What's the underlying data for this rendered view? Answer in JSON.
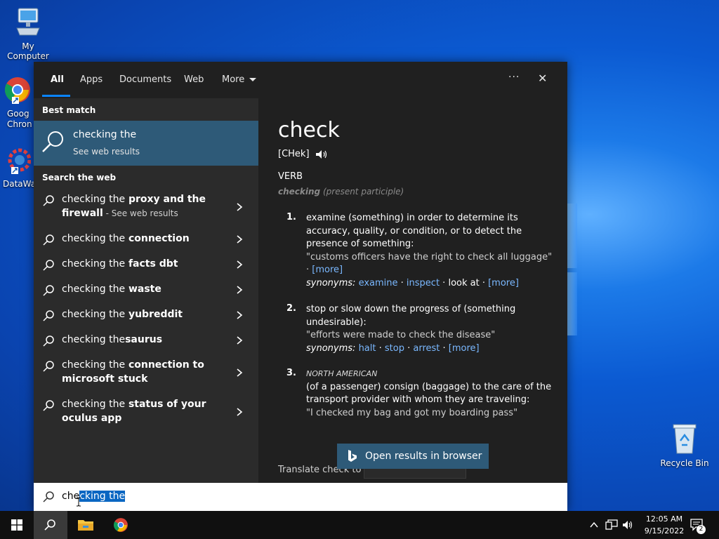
{
  "desktop": {
    "icons": [
      {
        "name": "my-computer",
        "label": "My Computer"
      },
      {
        "name": "google-chrome",
        "label": "Goog Chron"
      },
      {
        "name": "datawag",
        "label": "DataWag"
      },
      {
        "name": "recycle-bin",
        "label": "Recycle Bin"
      }
    ]
  },
  "search_panel": {
    "tabs": [
      {
        "label": "All",
        "active": true
      },
      {
        "label": "Apps"
      },
      {
        "label": "Documents"
      },
      {
        "label": "Web"
      },
      {
        "label": "More"
      }
    ],
    "more_options_label": "···",
    "close_label": "✕",
    "best_match": {
      "heading": "Best match",
      "title": "checking the",
      "subtitle": "See web results"
    },
    "search_web_heading": "Search the web",
    "suggestions": [
      {
        "prefix": "checking the",
        "bold": " proxy and the firewall",
        "suffix": " - See web results"
      },
      {
        "prefix": "checking the",
        "bold": " connection",
        "suffix": ""
      },
      {
        "prefix": "checking the",
        "bold": " facts dbt",
        "suffix": ""
      },
      {
        "prefix": "checking the",
        "bold": " waste",
        "suffix": ""
      },
      {
        "prefix": "checking the",
        "bold": " yubreddit",
        "suffix": ""
      },
      {
        "prefix": "checking the",
        "bold": "saurus",
        "suffix": ""
      },
      {
        "prefix": "checking the",
        "bold": " connection to microsoft stuck",
        "suffix": ""
      },
      {
        "prefix": "checking the",
        "bold": " status of your oculus app",
        "suffix": ""
      }
    ],
    "dictionary": {
      "word": "check",
      "pronunciation": "[CHek]",
      "part_of_speech": "VERB",
      "inflection_word": "checking",
      "inflection_note": " (present participle)",
      "definitions": [
        {
          "number": "1.",
          "text": "examine (something) in order to determine its accuracy, quality, or condition, or to detect the presence of something:",
          "example": "\"customs officers have the right to check all luggage\"",
          "example_more": "[more]",
          "synonyms_label": "synonyms:",
          "synonyms": [
            "examine",
            "inspect"
          ],
          "synonym_plain": "look at",
          "synonyms_more": "[more]"
        },
        {
          "number": "2.",
          "text": "stop or slow down the progress of (something undesirable):",
          "example": "\"efforts were made to check the disease\"",
          "synonyms_label": "synonyms:",
          "synonyms": [
            "halt",
            "stop",
            "arrest"
          ],
          "synonyms_more": "[more]"
        },
        {
          "number": "3.",
          "region": "NORTH AMERICAN",
          "text": "(of a passenger) consign (baggage) to the care of the transport provider with whom they are traveling:",
          "example": "\"I checked my bag and got my boarding pass\""
        }
      ],
      "open_results_label": "Open results in browser",
      "translate_label": "Translate check to"
    }
  },
  "searchbox": {
    "prefix": "che",
    "selected": "cking the"
  },
  "taskbar": {
    "time": "12:05 AM",
    "date": "9/15/2022",
    "notification_count": "2"
  },
  "colors": {
    "accent": "#0a84ff",
    "highlight": "#2e5a78",
    "panel_bg": "#202020",
    "left_bg": "#2b2b2b",
    "link": "#7ab8ff"
  }
}
